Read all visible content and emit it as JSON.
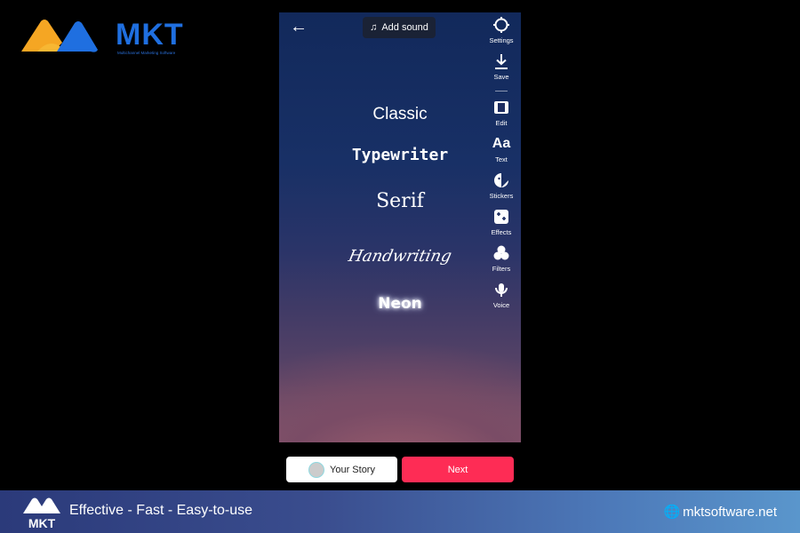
{
  "brand": {
    "logo_text": "MKT",
    "logo_subtitle": "Multichannel Marketing Software",
    "colors": {
      "orange": "#f5a623",
      "blue": "#1f6fe0"
    }
  },
  "editor": {
    "back_icon": "arrow-left-icon",
    "add_sound_label": "Add sound",
    "rail": [
      {
        "label": "Settings",
        "icon": "gear-icon"
      },
      {
        "label": "Save",
        "icon": "download-icon"
      },
      {
        "label": "Edit",
        "icon": "film-icon"
      },
      {
        "label": "Text",
        "icon": "text-aa-icon"
      },
      {
        "label": "Stickers",
        "icon": "sticker-icon"
      },
      {
        "label": "Effects",
        "icon": "effects-icon"
      },
      {
        "label": "Filters",
        "icon": "filters-icon"
      },
      {
        "label": "Voice",
        "icon": "voice-icon"
      }
    ],
    "text_aa": "Aa",
    "font_options": [
      "Classic",
      "Typewriter",
      "Serif",
      "Handwriting",
      "Neon"
    ]
  },
  "actions": {
    "your_story_label": "Your Story",
    "next_label": "Next",
    "next_color": "#fe2c55"
  },
  "footer": {
    "tagline": "Effective - Fast - Easy-to-use",
    "website": "mktsoftware.net",
    "logo_text": "MKT"
  }
}
